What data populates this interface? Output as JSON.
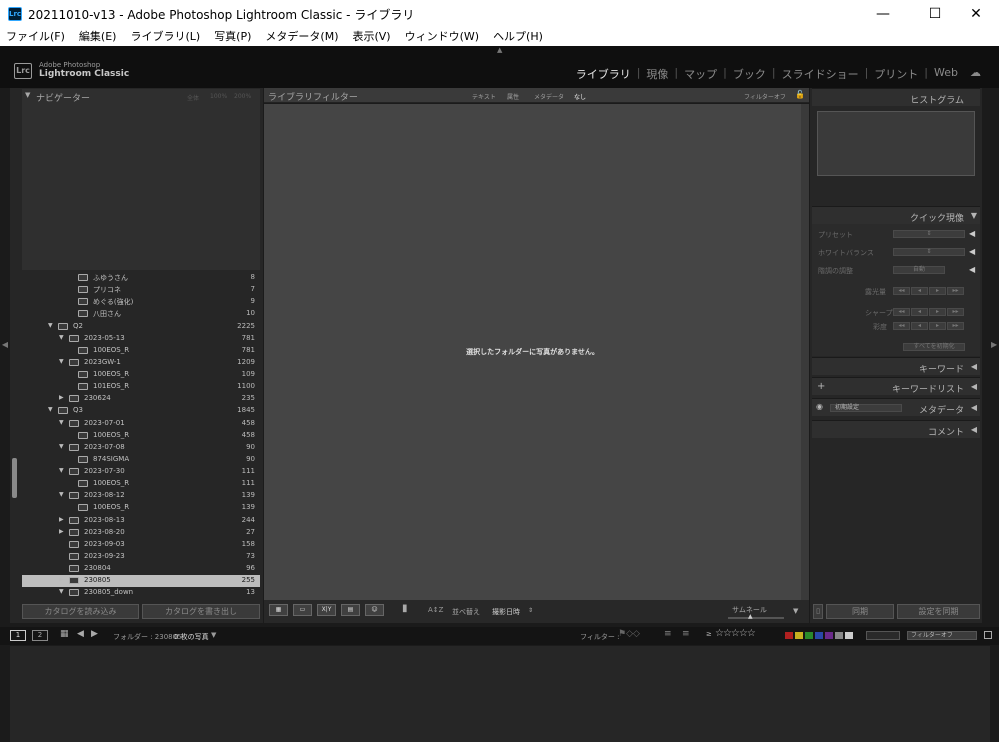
{
  "window": {
    "title": "20211010-v13 - Adobe Photoshop Lightroom Classic - ライブラリ",
    "app_badge": "Lrc",
    "minimize": "—",
    "maximize": "☐",
    "close": "✕"
  },
  "menu": [
    "ファイル(F)",
    "編集(E)",
    "ライブラリ(L)",
    "写真(P)",
    "メタデータ(M)",
    "表示(V)",
    "ウィンドウ(W)",
    "ヘルプ(H)"
  ],
  "identity": {
    "logo": "Lrc",
    "line1": "Adobe Photoshop",
    "line2": "Lightroom Classic"
  },
  "modules": [
    "ライブラリ",
    "現像",
    "マップ",
    "ブック",
    "スライドショー",
    "プリント",
    "Web"
  ],
  "navigator": {
    "title": "ナビゲーター",
    "zoom": [
      "全体",
      "100%",
      "200%"
    ]
  },
  "filter_bar": {
    "title": "ライブラリフィルター",
    "tabs": [
      "テキスト",
      "属性",
      "メタデータ",
      "なし"
    ],
    "preset": "フィルターオフ"
  },
  "folders": [
    {
      "name": "ふゆうさん",
      "count": "8",
      "level": 3,
      "expand": "",
      "sel": false
    },
    {
      "name": "プリコネ",
      "count": "7",
      "level": 3,
      "expand": "",
      "sel": false
    },
    {
      "name": "めぐる(強化)",
      "count": "9",
      "level": 3,
      "expand": "",
      "sel": false
    },
    {
      "name": "八田さん",
      "count": "10",
      "level": 3,
      "expand": "",
      "sel": false
    },
    {
      "name": "Q2",
      "count": "2225",
      "level": 1,
      "expand": "▼",
      "sel": false
    },
    {
      "name": "2023-05-13",
      "count": "781",
      "level": 2,
      "expand": "▼",
      "sel": false
    },
    {
      "name": "100EOS_R",
      "count": "781",
      "level": 3,
      "expand": "",
      "sel": false
    },
    {
      "name": "2023GW-1",
      "count": "1209",
      "level": 2,
      "expand": "▼",
      "sel": false
    },
    {
      "name": "100EOS_R",
      "count": "109",
      "level": 3,
      "expand": "",
      "sel": false
    },
    {
      "name": "101EOS_R",
      "count": "1100",
      "level": 3,
      "expand": "",
      "sel": false
    },
    {
      "name": "230624",
      "count": "235",
      "level": 2,
      "expand": "▶",
      "sel": false
    },
    {
      "name": "Q3",
      "count": "1845",
      "level": 1,
      "expand": "▼",
      "sel": false
    },
    {
      "name": "2023-07-01",
      "count": "458",
      "level": 2,
      "expand": "▼",
      "sel": false
    },
    {
      "name": "100EOS_R",
      "count": "458",
      "level": 3,
      "expand": "",
      "sel": false
    },
    {
      "name": "2023-07-08",
      "count": "90",
      "level": 2,
      "expand": "▼",
      "sel": false
    },
    {
      "name": "874SIGMA",
      "count": "90",
      "level": 3,
      "expand": "",
      "sel": false
    },
    {
      "name": "2023-07-30",
      "count": "111",
      "level": 2,
      "expand": "▼",
      "sel": false
    },
    {
      "name": "100EOS_R",
      "count": "111",
      "level": 3,
      "expand": "",
      "sel": false
    },
    {
      "name": "2023-08-12",
      "count": "139",
      "level": 2,
      "expand": "▼",
      "sel": false
    },
    {
      "name": "100EOS_R",
      "count": "139",
      "level": 3,
      "expand": "",
      "sel": false
    },
    {
      "name": "2023-08-13",
      "count": "244",
      "level": 2,
      "expand": "▶",
      "sel": false
    },
    {
      "name": "2023-08-20",
      "count": "27",
      "level": 2,
      "expand": "▶",
      "sel": false
    },
    {
      "name": "2023-09-03",
      "count": "158",
      "level": 2,
      "expand": "",
      "sel": false
    },
    {
      "name": "2023-09-23",
      "count": "73",
      "level": 2,
      "expand": "",
      "sel": false
    },
    {
      "name": "230804",
      "count": "96",
      "level": 2,
      "expand": "",
      "sel": false
    },
    {
      "name": "230805",
      "count": "255",
      "level": 2,
      "expand": "▶",
      "sel": true
    },
    {
      "name": "230805_down",
      "count": "13",
      "level": 2,
      "expand": "▼",
      "sel": false
    }
  ],
  "left_buttons": {
    "import": "カタログを読み込み",
    "export": "カタログを書き出し"
  },
  "main": {
    "empty_message": "選択したフォルダーに写真がありません。"
  },
  "toolbar": {
    "sort_label": "並べ替え",
    "sort_value": "撮影日時",
    "thumb_label": "サムネール",
    "xy": "X|Y",
    "az": "A↕Z"
  },
  "right": {
    "histogram": "ヒストグラム",
    "quick_develop": "クイック現像",
    "preset": "プリセット",
    "white_balance": "ホワイトバランス",
    "tone": "階調の調整",
    "auto": "自動",
    "exposure": "露光量",
    "sharpness": "シャープ",
    "saturation": "彩度",
    "reset_all": "すべてを初期化",
    "keywording": "キーワード",
    "keyword_list": "キーワードリスト",
    "metadata": "メタデータ",
    "metadata_preset": "初期設定",
    "comments": "コメント",
    "sync": "同期",
    "sync_settings": "設定を同期"
  },
  "filmstrip": {
    "screen1": "1",
    "screen2": "2",
    "source": "フォルダー : 230805",
    "count": "0 枚の写真",
    "filter_label": "フィルター :",
    "stars": "☆☆☆☆☆",
    "filter_value": "フィルターオフ"
  },
  "colors": {
    "accent_label": [
      "#b02020",
      "#c8b020",
      "#2a8a2a",
      "#2a48a8",
      "#6a2a8a",
      "#888888",
      "#cccccc"
    ]
  }
}
